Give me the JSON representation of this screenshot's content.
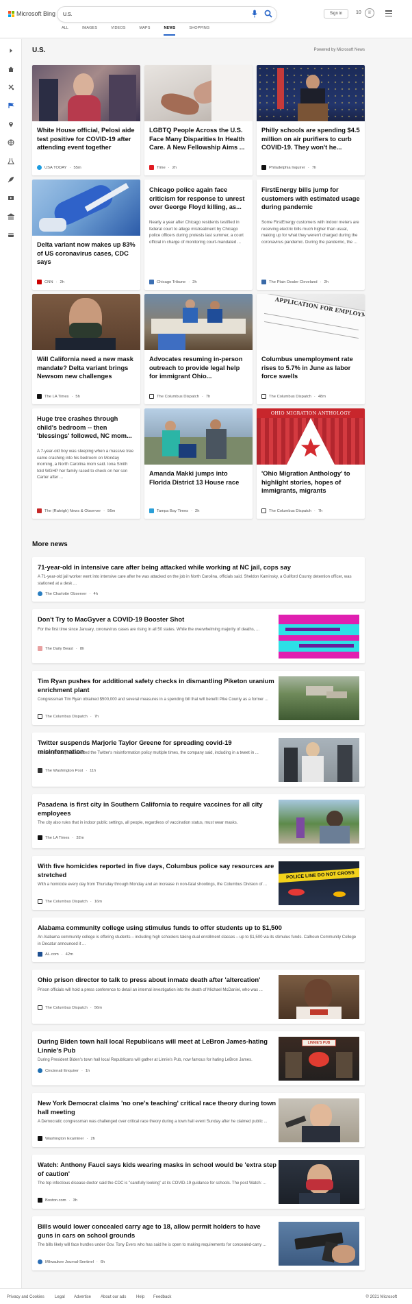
{
  "brand": {
    "name": "Microsoft Bing"
  },
  "search": {
    "value": "U.S."
  },
  "header": {
    "sign_in": "Sign in",
    "rewards_count": "10"
  },
  "nav": {
    "items": [
      "ALL",
      "IMAGES",
      "VIDEOS",
      "MAPS",
      "NEWS",
      "SHOPPING"
    ],
    "active": "NEWS"
  },
  "section": {
    "title": "U.S.",
    "powered_by": "Powered by Microsoft News"
  },
  "cards": [
    {
      "title": "White House official, Pelosi aide test positive for COVID-19 after attending event together",
      "source": "USA TODAY",
      "time": "55m",
      "image": "pelosi-photo"
    },
    {
      "title": "LGBTQ People Across the U.S. Face Many Disparities In Health Care. A New Fellowship Aims ...",
      "source": "Time",
      "time": "2h",
      "image": "healthcare-photo"
    },
    {
      "title": "Philly schools are spending $4.5 million on air purifiers to curb COVID-19. They won't he...",
      "source": "Philadelphia Inquirer",
      "time": "7h",
      "image": "podium-photo"
    },
    {
      "title": "Delta variant now makes up 83% of US coronavirus cases, CDC says",
      "source": "CNN",
      "time": "2h",
      "image": "syringe-photo"
    },
    {
      "title": "Chicago police again face criticism for response to unrest over George Floyd killing, as...",
      "snippet": "Nearly a year after Chicago residents testified in federal court to allege mistreatment by Chicago police officers during protests last summer, a court official in charge of monitoring court-mandated ...",
      "source": "Chicago Tribune",
      "time": "2h"
    },
    {
      "title": "FirstEnergy bills jump for customers with estimated usage during pandemic",
      "snippet": "Some FirstEnergy customers with indoor meters are receiving electric bills much higher than usual, making up for what they weren't charged during the coronavirus pandemic. During the pandemic, the ...",
      "source": "The Plain Dealer Cleveland",
      "time": "2h"
    },
    {
      "title": "Will California need a new mask mandate? Delta variant brings Newsom new challenges",
      "source": "The LA Times",
      "time": "5h",
      "image": "newsom-photo"
    },
    {
      "title": "Advocates resuming in-person outreach to provide legal help for immigrant Ohio...",
      "source": "The Columbus Dispatch",
      "time": "7h",
      "image": "outreach-photo"
    },
    {
      "title": "Columbus unemployment rate rises to 5.7% in June as labor force swells",
      "source": "The Columbus Dispatch",
      "time": "48m",
      "image": "employment-photo",
      "image_text": "APPLICATION FOR EMPLOYMENT"
    },
    {
      "title": "Huge tree crashes through child's bedroom -- then 'blessings' followed, NC mom...",
      "snippet": "A 7-year-old boy was sleeping when a massive tree came crashing into his bedroom on Monday morning, a North Carolina mom said. Iona Smith told WGHP her family raced to check on her son Carter after ...",
      "source": "The (Raleigh) News & Observer",
      "time": "56m"
    },
    {
      "title": "Amanda Makki jumps into Florida District 13 House race",
      "source": "Tampa Bay Times",
      "time": "2h",
      "image": "campaign-photo"
    },
    {
      "title": "'Ohio Migration Anthology' to highlight stories, hopes of immigrants, migrants",
      "source": "The Columbus Dispatch",
      "time": "7h",
      "image": "anthology-photo",
      "image_text": "OHIO MIGRATION ANTHOLOGY"
    }
  ],
  "more_news": {
    "title": "More news",
    "items": [
      {
        "title": "71-year-old in intensive care after being attacked while working at NC jail, cops say",
        "snippet": "A 71-year-old jail worker went into intensive care after he was attacked on the job in North Carolina, officials said. Sheldon Kaminsky, a Guilford County detention officer, was stationed at a desk ...",
        "source": "The Charlotte Observer",
        "time": "4h"
      },
      {
        "title": "Don't Try to MacGyver a COVID-19 Booster Shot",
        "snippet": "For the first time since January, coronavirus cases are rising in all 50 states. While the overwhelming majority of deaths, ...",
        "source": "The Daily Beast",
        "time": "8h",
        "image": "syringe-illustration"
      },
      {
        "title": "Tim Ryan pushes for additional safety checks in dismantling Piketon uranium enrichment plant",
        "snippet": "Congressman Tim Ryan obtained $500,000 and several measures in a spending bill that will benefit Pike County as a former ...",
        "source": "The Columbus Dispatch",
        "time": "7h",
        "image": "aerial-plant-photo"
      },
      {
        "title": "Twitter suspends Marjorie Taylor Greene for spreading covid-19 misinformation",
        "snippet": "Greene (R-Ga.) had violated the Twitter's misinformation policy multiple times, the company said, including in a tweet in ...",
        "source": "The Washington Post",
        "time": "11h",
        "image": "greene-photo"
      },
      {
        "title": "Pasadena is first city in Southern California to require vaccines for all city employees",
        "snippet": "The city also rules that in indoor public settings, all people, regardless of vaccination status, must wear masks.",
        "source": "The LA Times",
        "time": "32m",
        "image": "pasadena-photo"
      },
      {
        "title": "With five homicides reported in five days, Columbus police say resources are stretched",
        "snippet": "With a homicide every day from Thursday through Monday and an increase in non-fatal shootings, the Columbus Division of ...",
        "source": "The Columbus Dispatch",
        "time": "16m",
        "image": "police-tape-photo",
        "image_text": "POLICE LINE DO NOT CROSS"
      },
      {
        "title": "Alabama community college using stimulus funds to offer students up to $1,500",
        "snippet": "An Alabama community college is offering students – including high schoolers taking dual enrollment classes – up to $1,500 via its stimulus funds. Calhoun Community College in Decatur announced it ...",
        "source": "AL.com",
        "time": "42m"
      },
      {
        "title": "Ohio prison director to talk to press about inmate death after 'altercation'",
        "snippet": "Prison officials will hold a press conference to detail an internal investigation into the death of Michael McDaniel, who was ...",
        "source": "The Columbus Dispatch",
        "time": "56m",
        "image": "mcdaniel-photo"
      },
      {
        "title": "During Biden town hall local Republicans will meet at LeBron James-hating Linnie's Pub",
        "snippet": "During President Biden's town hall local Republicans will gather at Linnie's Pub, now famous for hating LeBron James.",
        "source": "Cincinnati Enquirer",
        "time": "1h",
        "image": "linnies-pub-photo",
        "image_text": "LINNIE'S PUB"
      },
      {
        "title": "New York Democrat claims 'no one's teaching' critical race theory during town hall meeting",
        "snippet": "A Democratic congressman was challenged over critical race theory during a town hall event Sunday after he claimed public ...",
        "source": "Washington Examiner",
        "time": "2h",
        "image": "congressman-photo"
      },
      {
        "title": "Watch: Anthony Fauci says kids wearing masks in school would be 'extra step of caution'",
        "snippet": "The top infectious disease doctor said the CDC is \"carefully looking\" at its COVID-19 guidance for schools. The post Watch: ...",
        "source": "Boston.com",
        "time": "3h",
        "image": "fauci-photo"
      },
      {
        "title": "Bills would lower concealed carry age to 18, allow permit holders to have guns in cars on school grounds",
        "snippet": "The bills likely will face hurdles under Gov. Tony Evers who has said he is open to making requirements for concealed-carry ...",
        "source": "Milwaukee Journal-Sentinel",
        "time": "6h",
        "image": "handgun-photo"
      }
    ]
  },
  "footer": {
    "links": [
      "Privacy and Cookies",
      "Legal",
      "Advertise",
      "About our ads",
      "Help",
      "Feedback"
    ],
    "copyright": "© 2021 Microsoft"
  },
  "colors": {
    "accent": "#2563c7",
    "background": "#f5f5f5",
    "card": "#ffffff"
  },
  "icons": [
    "search-icon",
    "microphone-icon",
    "rewards-icon",
    "hamburger-menu-icon",
    "expand-icon",
    "home-icon",
    "sports-icon",
    "flag-icon",
    "pin-icon",
    "globe-icon",
    "science-icon",
    "rocket-icon",
    "film-icon",
    "bank-icon",
    "wallet-icon"
  ]
}
